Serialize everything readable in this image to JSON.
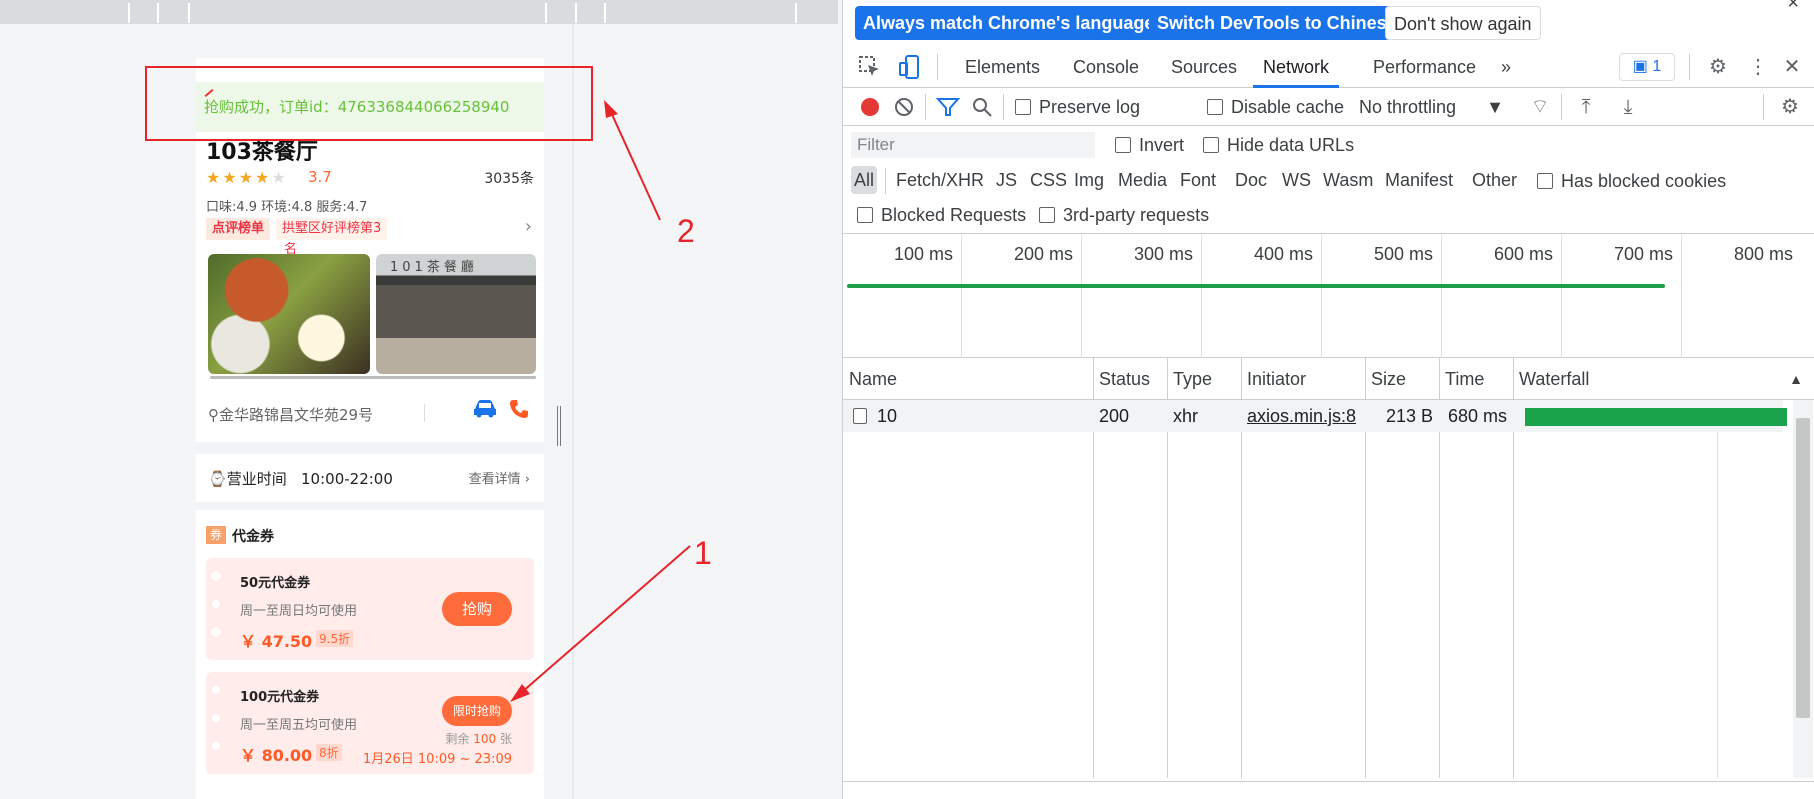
{
  "preview": {
    "toast": "抢购成功，订单id：476336844066258940",
    "shop_name": "103茶餐厅",
    "rating": "3.7",
    "review_count": "3035条",
    "sub_scores": "口味:4.9 环境:4.8 服务:4.7",
    "rank_badge": "点评榜单",
    "rank_text": "拱墅区好评榜第3",
    "rank_text2": "名",
    "storefront_sign": "101茶餐廳",
    "address": "金华路锦昌文华苑29号",
    "hours_label": "营业时间",
    "hours_value": "10:00-22:00",
    "hours_more": "查看详情",
    "coupon_section_icon": "券",
    "coupon_section_title": "代金券",
    "coupons": [
      {
        "name": "50元代金券",
        "desc": "周一至周日均可使用",
        "price": "￥ 47.50",
        "discount": "9.5折",
        "button": "抢购"
      },
      {
        "name": "100元代金券",
        "desc": "周一至周五均可使用",
        "price": "￥ 80.00",
        "discount": "8折",
        "button": "限时抢购",
        "remain_prefix": "剩余",
        "remain_count": "100",
        "remain_suffix": "张",
        "time": "1月26日 10:09 ~ 23:09"
      }
    ],
    "annotations": {
      "one": "1",
      "two": "2"
    },
    "colors": {
      "accent": "#ff6b3b",
      "success": "#67c23a",
      "annotation": "#e8232a"
    }
  },
  "devtools": {
    "infobar": {
      "match_lang": "Always match Chrome's language",
      "switch_lang": "Switch DevTools to Chinese",
      "dont_show": "Don't show again",
      "close": "×"
    },
    "tabs": [
      "Elements",
      "Console",
      "Sources",
      "Network",
      "Performance"
    ],
    "more_tabs": "»",
    "issues_count": "1",
    "toolbar": {
      "preserve_log": "Preserve log",
      "disable_cache": "Disable cache",
      "throttling": "No throttling"
    },
    "filter": {
      "placeholder": "Filter",
      "invert": "Invert",
      "hide_data_urls": "Hide data URLs",
      "types": [
        "All",
        "Fetch/XHR",
        "JS",
        "CSS",
        "Img",
        "Media",
        "Font",
        "Doc",
        "WS",
        "Wasm",
        "Manifest",
        "Other"
      ],
      "has_blocked_cookies": "Has blocked cookies",
      "blocked_requests": "Blocked Requests",
      "third_party": "3rd-party requests"
    },
    "overview_ticks": [
      "100 ms",
      "200 ms",
      "300 ms",
      "400 ms",
      "500 ms",
      "600 ms",
      "700 ms",
      "800 ms"
    ],
    "columns": [
      "Name",
      "Status",
      "Type",
      "Initiator",
      "Size",
      "Time",
      "Waterfall"
    ],
    "rows": [
      {
        "name": "10",
        "status": "200",
        "type": "xhr",
        "initiator": "axios.min.js:8",
        "size": "213 B",
        "time": "680 ms"
      }
    ],
    "colors": {
      "primary": "#1a73e8",
      "waterfall": "#1aa34a"
    }
  }
}
